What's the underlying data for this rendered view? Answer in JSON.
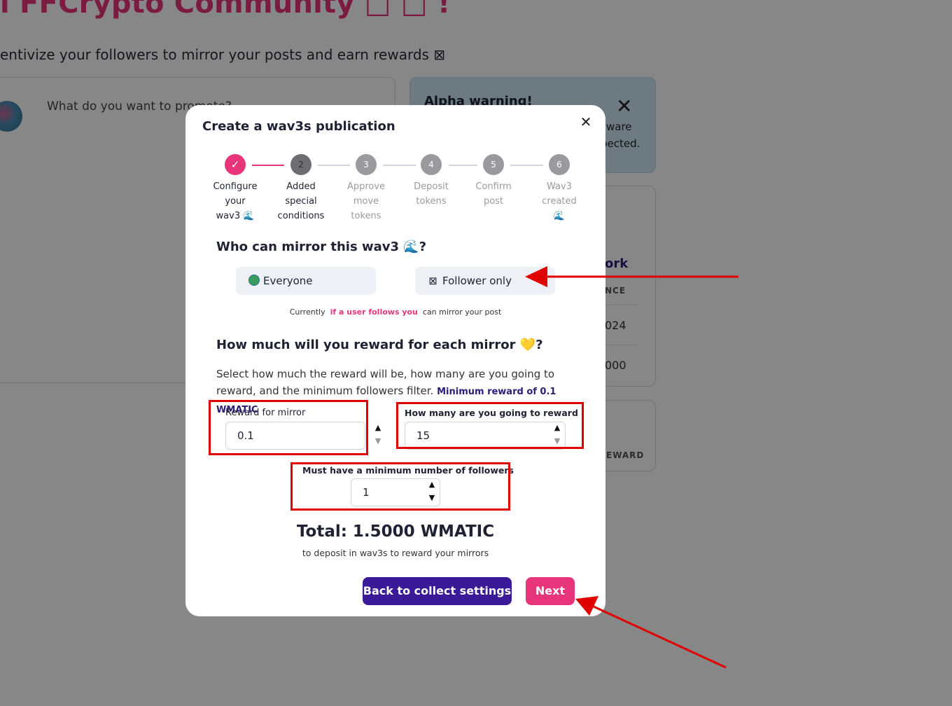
{
  "background": {
    "title": "i FFCrypto Community □ □ !",
    "subtitle": "entivize your followers to mirror your posts and earn rewards ⊠",
    "promote_placeholder": "What do you want to promote?",
    "alpha_title": "Alpha warning!",
    "alpha_line1": "ware",
    "alpha_line2": "pected.",
    "network_title": "ork",
    "network_header": "NCE",
    "network_value1": "024",
    "network_value2": "000",
    "reward_header": "EWARD"
  },
  "modal": {
    "title": "Create a wav3s publication",
    "close_glyph": "✕",
    "steps": [
      {
        "number": "✓",
        "l1": "Configure",
        "l2": "your",
        "l3": "wav3 🌊",
        "state": "done"
      },
      {
        "number": "2",
        "l1": "Added",
        "l2": "special",
        "l3": "conditions",
        "state": "active"
      },
      {
        "number": "3",
        "l1": "Approve",
        "l2": "move",
        "l3": "tokens",
        "state": "pending"
      },
      {
        "number": "4",
        "l1": "Deposit",
        "l2": "tokens",
        "l3": "",
        "state": "pending"
      },
      {
        "number": "5",
        "l1": "Confirm",
        "l2": "post",
        "l3": "",
        "state": "pending"
      },
      {
        "number": "6",
        "l1": "Wav3",
        "l2": "created",
        "l3": "🌊",
        "state": "pending"
      }
    ],
    "mirror": {
      "title": "Who can mirror this wav3 🌊?",
      "option_everyone": "Everyone",
      "option_follower": "Follower only",
      "follower_icon": "⊠",
      "current_prefix": "Currently",
      "current_highlight": "if a user follows you",
      "current_suffix": "can mirror your post"
    },
    "reward": {
      "title": "How much will you reward for each mirror 💛?",
      "description": "Select how much the reward will be, how many are you going to reward, and the minimum followers filter.",
      "min_note": "Minimum reward of 0.1 WMATIC",
      "reward_label": "Reward for mirror",
      "reward_value": "0.1",
      "count_label": "How many are you going to reward",
      "count_value": "15",
      "followers_label": "Must have a minimum number of followers",
      "followers_value": "1"
    },
    "total": "Total: 1.5000 WMATIC",
    "total_sub": "to deposit in wav3s to reward your mirrors",
    "back_button": "Back to collect settings",
    "next_button": "Next"
  },
  "colors": {
    "accent_pink": "#e8347a",
    "accent_purple": "#3a1a96",
    "annotation_red": "#e00000"
  }
}
